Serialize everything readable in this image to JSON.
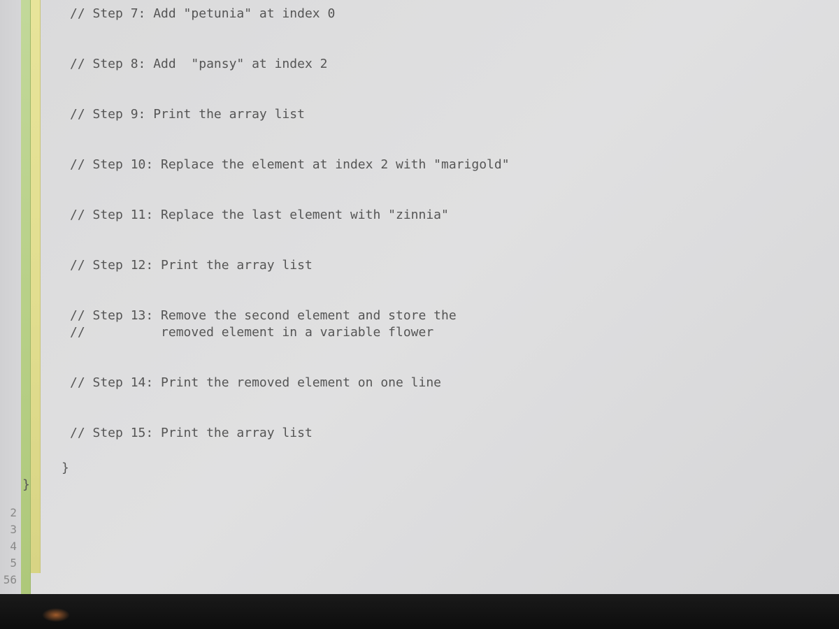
{
  "gutter": {
    "lines": [
      "2",
      "3",
      "4",
      "5",
      "56"
    ]
  },
  "code": {
    "step7": "// Step 7: Add \"petunia\" at index 0",
    "step8": "// Step 8: Add  \"pansy\" at index 2",
    "step9": "// Step 9: Print the array list",
    "step10": "// Step 10: Replace the element at index 2 with \"marigold\"",
    "step11": "// Step 11: Replace the last element with \"zinnia\"",
    "step12": "// Step 12: Print the array list",
    "step13a": "// Step 13: Remove the second element and store the",
    "step13b": "//          removed element in a variable flower",
    "step14": "// Step 14: Print the removed element on one line",
    "step15": "// Step 15: Print the array list",
    "brace1": "}",
    "brace2": "}"
  }
}
